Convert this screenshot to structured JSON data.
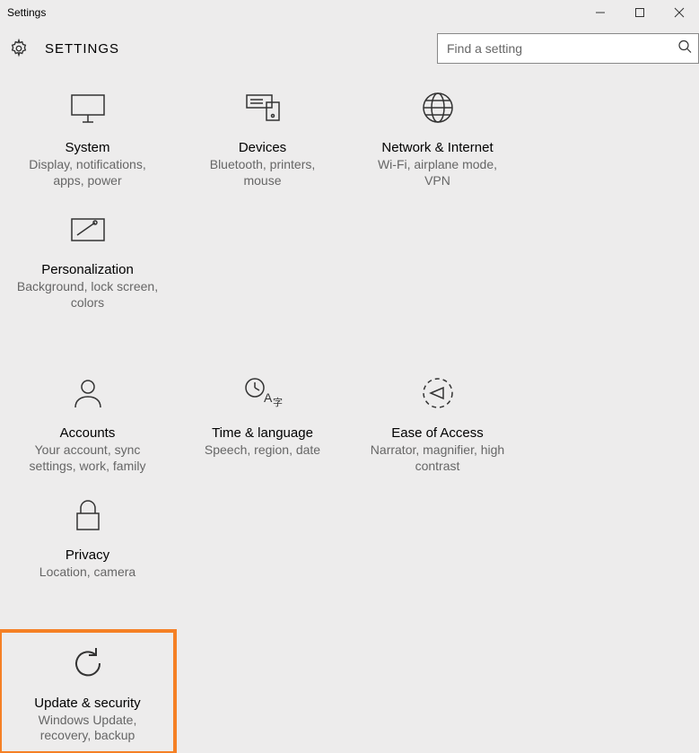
{
  "window": {
    "title": "Settings"
  },
  "header": {
    "title": "SETTINGS"
  },
  "search": {
    "placeholder": "Find a setting"
  },
  "tiles": [
    {
      "title": "System",
      "sub": "Display, notifications, apps, power"
    },
    {
      "title": "Devices",
      "sub": "Bluetooth, printers, mouse"
    },
    {
      "title": "Network & Internet",
      "sub": "Wi-Fi, airplane mode, VPN"
    },
    {
      "title": "Personalization",
      "sub": "Background, lock screen, colors"
    },
    {
      "title": "Accounts",
      "sub": "Your account, sync settings, work, family"
    },
    {
      "title": "Time & language",
      "sub": "Speech, region, date"
    },
    {
      "title": "Ease of Access",
      "sub": "Narrator, magnifier, high contrast"
    },
    {
      "title": "Privacy",
      "sub": "Location, camera"
    },
    {
      "title": "Update & security",
      "sub": "Windows Update, recovery, backup"
    }
  ]
}
